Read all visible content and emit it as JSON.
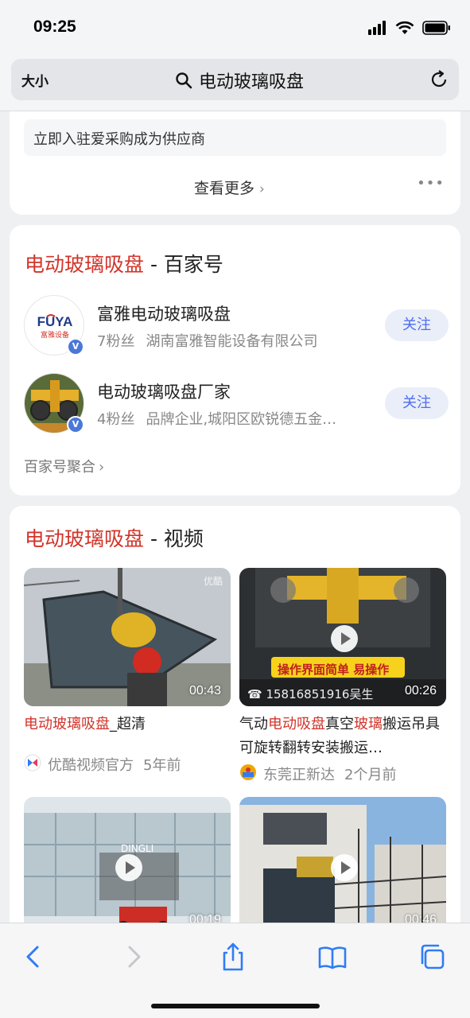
{
  "status_bar": {
    "time": "09:25"
  },
  "address_bar": {
    "text_size_label": "大小",
    "query": "电动玻璃吸盘"
  },
  "top_card": {
    "supplier_text": "立即入驻爱采购成为供应商",
    "more_label": "查看更多",
    "more_chevron": "›"
  },
  "baijiahao": {
    "title_highlight": "电动玻璃吸盘",
    "title_rest": " - 百家号",
    "accounts": [
      {
        "name": "富雅电动玻璃吸盘",
        "fans": "7粉丝",
        "desc": "湖南富雅智能设备有限公司",
        "follow_label": "关注",
        "logo_text": "FUYA",
        "logo_sub": "富雅设备"
      },
      {
        "name": "电动玻璃吸盘厂家",
        "fans": "4粉丝",
        "desc": "品牌企业,城阳区欧锐德五金…",
        "follow_label": "关注"
      }
    ],
    "aggregate_label": "百家号聚合",
    "aggregate_chevron": "›"
  },
  "videos": {
    "title_highlight": "电动玻璃吸盘",
    "title_rest": " - 视频",
    "items": [
      {
        "duration": "00:43",
        "watermark": "优酷",
        "title_parts": [
          "电动玻璃吸盘",
          "_超清"
        ],
        "source": "优酷视频官方",
        "time": "5年前"
      },
      {
        "duration": "00:26",
        "banner": "操作界面简单  易操作",
        "phone": "15816851916吴生",
        "title_parts": [
          "气动",
          "电动吸盘",
          "真空",
          "玻璃",
          "搬运吊具可旋转翻转安装搬运…"
        ],
        "source": "东莞正新达",
        "time": "2个月前"
      },
      {
        "duration": "00:19",
        "brand": "DINGLI"
      },
      {
        "duration": "00:46"
      }
    ]
  },
  "toolbar": {
    "icons": [
      "back-icon",
      "forward-icon",
      "share-icon",
      "bookmarks-icon",
      "tabs-icon"
    ]
  },
  "colors": {
    "highlight": "#d2342a",
    "follow_text": "#4e6ef2",
    "ios_blue": "#2f7cf6"
  }
}
